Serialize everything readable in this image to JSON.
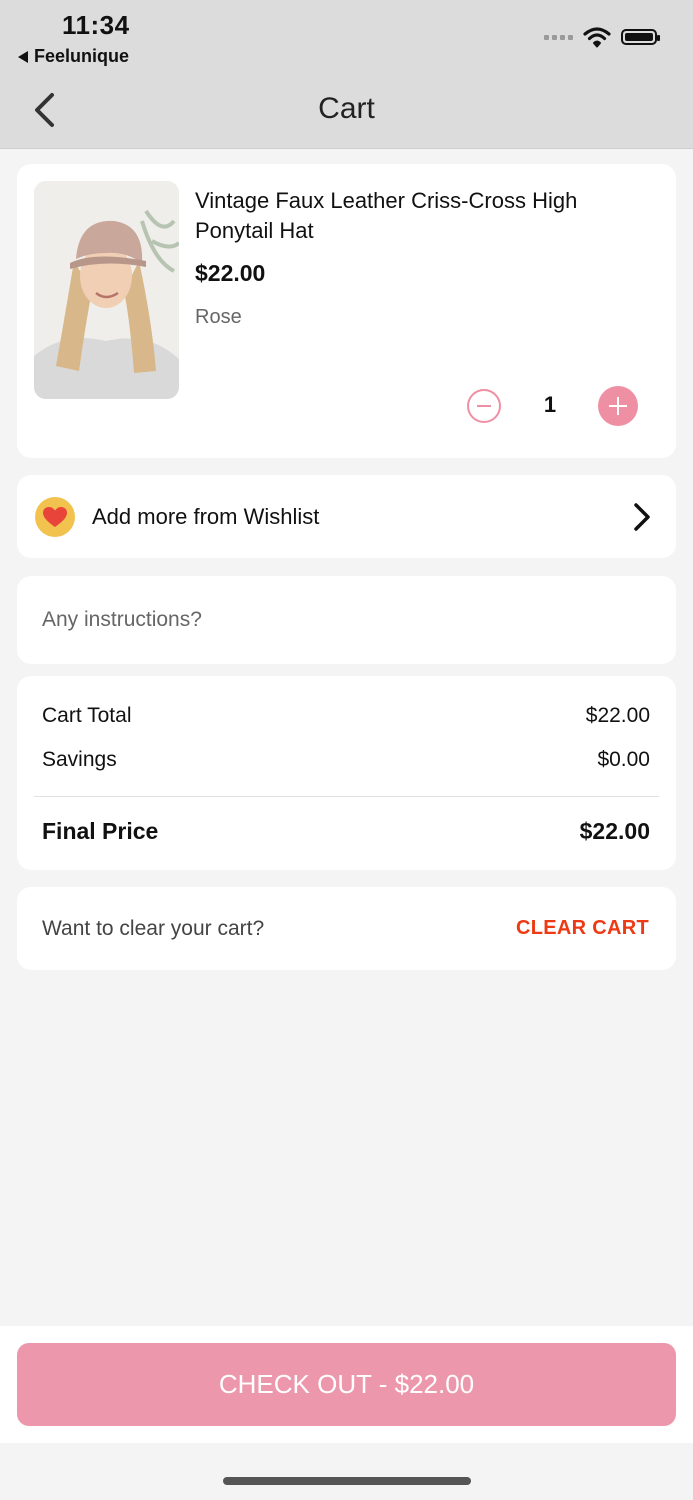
{
  "status_bar": {
    "time": "11:34",
    "back_app": "Feelunique",
    "icons": [
      "signal-icon",
      "wifi-icon",
      "battery-icon"
    ]
  },
  "nav": {
    "title": "Cart",
    "back_icon": "chevron-left-icon"
  },
  "product": {
    "name": "Vintage Faux Leather Criss-Cross High Ponytail Hat",
    "price": "$22.00",
    "variant": "Rose",
    "quantity": "1"
  },
  "wishlist": {
    "label": "Add more from Wishlist",
    "icon": "heart-icon"
  },
  "instructions": {
    "placeholder": "Any instructions?"
  },
  "summary": {
    "cart_total_label": "Cart Total",
    "cart_total_value": "$22.00",
    "savings_label": "Savings",
    "savings_value": "$0.00",
    "final_price_label": "Final Price",
    "final_price_value": "$22.00"
  },
  "clear": {
    "question": "Want to clear your cart?",
    "button_label": "CLEAR CART"
  },
  "checkout": {
    "label": "CHECK OUT - $22.00"
  },
  "colors": {
    "accent": "#ec97ab",
    "clear_cart": "#ee3a14"
  }
}
